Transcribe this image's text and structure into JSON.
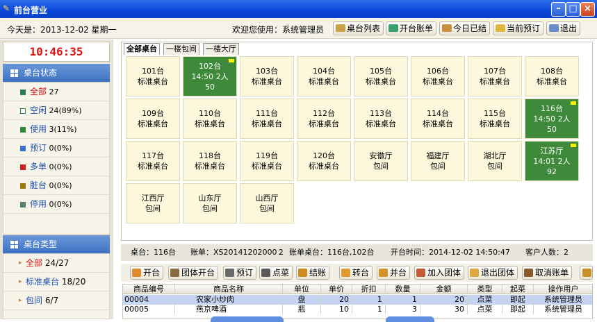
{
  "window": {
    "title": "前台营业"
  },
  "topbar": {
    "today": "今天是：2013-12-02 星期一",
    "welcome": "欢迎您使用：系统管理员",
    "buttons": [
      "桌台列表",
      "开台账单",
      "今日已结",
      "当前预订",
      "退出"
    ]
  },
  "clock": "10:46:35",
  "status_panel": {
    "title": "桌台状态",
    "items": [
      {
        "name": "全部",
        "count": "27",
        "color": "#2e7d5b"
      },
      {
        "name": "空闲",
        "count": "24(89%)",
        "color": "#ffffff"
      },
      {
        "name": "使用",
        "count": "3(11%)",
        "color": "#2e8b3a"
      },
      {
        "name": "预订",
        "count": "0(0%)",
        "color": "#3a6fd8"
      },
      {
        "name": "多单",
        "count": "0(0%)",
        "color": "#cc2020"
      },
      {
        "name": "脏台",
        "count": "0(0%)",
        "color": "#a07810"
      },
      {
        "name": "停用",
        "count": "0(0%)",
        "color": "#5a8070"
      }
    ]
  },
  "type_panel": {
    "title": "桌台类型",
    "items": [
      {
        "name": "全部",
        "count": "24/27"
      },
      {
        "name": "标准桌台",
        "count": "18/20"
      },
      {
        "name": "包间",
        "count": "6/7"
      }
    ]
  },
  "tabs": [
    "全部桌台",
    "一楼包间",
    "一楼大厅"
  ],
  "tables": [
    {
      "name": "101台",
      "type": "标准桌台"
    },
    {
      "name": "102台",
      "time": "14:50 2人",
      "amount": "50",
      "busy": true
    },
    {
      "name": "103台",
      "type": "标准桌台"
    },
    {
      "name": "104台",
      "type": "标准桌台"
    },
    {
      "name": "105台",
      "type": "标准桌台"
    },
    {
      "name": "106台",
      "type": "标准桌台"
    },
    {
      "name": "107台",
      "type": "标准桌台"
    },
    {
      "name": "108台",
      "type": "标准桌台"
    },
    {
      "name": "109台",
      "type": "标准桌台"
    },
    {
      "name": "110台",
      "type": "标准桌台"
    },
    {
      "name": "111台",
      "type": "标准桌台"
    },
    {
      "name": "112台",
      "type": "标准桌台"
    },
    {
      "name": "113台",
      "type": "标准桌台"
    },
    {
      "name": "114台",
      "type": "标准桌台"
    },
    {
      "name": "115台",
      "type": "标准桌台"
    },
    {
      "name": "116台",
      "time": "14:50 2人",
      "amount": "50",
      "busy": true
    },
    {
      "name": "117台",
      "type": "标准桌台"
    },
    {
      "name": "118台",
      "type": "标准桌台"
    },
    {
      "name": "119台",
      "type": "标准桌台"
    },
    {
      "name": "120台",
      "type": "标准桌台"
    },
    {
      "name": "安徽厅",
      "type": "包间"
    },
    {
      "name": "福建厅",
      "type": "包间"
    },
    {
      "name": "湖北厅",
      "type": "包间"
    },
    {
      "name": "江苏厅",
      "time": "14:01 2人",
      "amount": "92",
      "busy": true
    },
    {
      "name": "江西厅",
      "type": "包间"
    },
    {
      "name": "山东厅",
      "type": "包间"
    },
    {
      "name": "山西厅",
      "type": "包间"
    }
  ],
  "info": {
    "table": "桌台：116台",
    "bill": "账单：XS20141202000２",
    "bill_tables": "账单桌台：116台,102台",
    "open_time": "开台时间：2014-12-02 14:50:47",
    "guests": "客户人数：2"
  },
  "actions": [
    "开台",
    "团体开台",
    "预订",
    "点菜",
    "结账",
    "转台",
    "并台",
    "加入团体",
    "退出团体",
    "取消账单"
  ],
  "order_grid": {
    "columns": [
      "商品编号",
      "商品名称",
      "单位",
      "单价",
      "折扣",
      "数量",
      "金额",
      "类型",
      "起菜",
      "操作用户"
    ],
    "rows": [
      [
        "00004",
        "农家小炒肉",
        "盘",
        "20",
        "1",
        "1",
        "20",
        "点菜",
        "即起",
        "系统管理员"
      ],
      [
        "00005",
        "燕京啤酒",
        "瓶",
        "10",
        "1",
        "3",
        "30",
        "点菜",
        "即起",
        "系统管理员"
      ]
    ]
  }
}
